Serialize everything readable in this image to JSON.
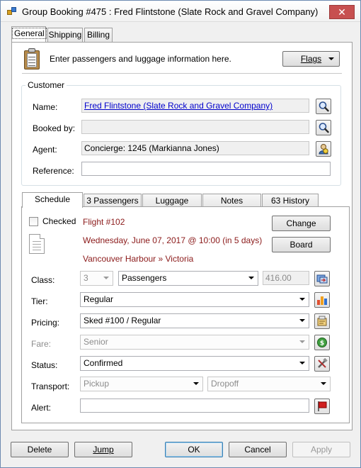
{
  "window": {
    "title": "Group Booking #475 : Fred Flintstone (Slate Rock and Gravel Company)",
    "close_glyph": "✕"
  },
  "top_tabs": [
    "General",
    "Shipping",
    "Billing"
  ],
  "intro": {
    "text": "Enter passengers and luggage information here.",
    "flags_button": "Flags"
  },
  "customer": {
    "group_label": "Customer",
    "name_label": "Name:",
    "name_value": "Fred Flintstone (Slate Rock and Gravel Company)",
    "booked_by_label": "Booked by:",
    "booked_by_value": "",
    "agent_label": "Agent:",
    "agent_value": "Concierge: 1245 (Markianna Jones)",
    "reference_label": "Reference:",
    "reference_value": ""
  },
  "inner_tabs": [
    "Schedule",
    "3 Passengers",
    "Luggage",
    "Notes",
    "63 History"
  ],
  "schedule": {
    "checked_label": "Checked",
    "checked": false,
    "flight": "Flight #102",
    "datetime": "Wednesday, June 07, 2017 @ 10:00 (in 5 days)",
    "route": "Vancouver Harbour » Victoria",
    "change_button": "Change",
    "board_button": "Board",
    "class_label": "Class:",
    "class_qty": "3",
    "class_value": "Passengers",
    "class_price": "416.00",
    "tier_label": "Tier:",
    "tier_value": "Regular",
    "pricing_label": "Pricing:",
    "pricing_value": "Sked #100 / Regular",
    "fare_label": "Fare:",
    "fare_value": "Senior",
    "status_label": "Status:",
    "status_value": "Confirmed",
    "transport_label": "Transport:",
    "pickup_value": "Pickup",
    "dropoff_value": "Dropoff",
    "alert_label": "Alert:",
    "alert_value": ""
  },
  "footer": {
    "delete": "Delete",
    "jump": "Jump",
    "ok": "OK",
    "cancel": "Cancel",
    "apply": "Apply"
  },
  "icons": {
    "app": "app-icon",
    "clipboard": "clipboard-icon",
    "search": "search-icon",
    "agent": "agent-icon",
    "document": "document-icon",
    "class_action": "card-swap-icon",
    "tier": "bar-chart-icon",
    "pricing": "price-tag-icon",
    "fare": "money-icon",
    "status": "tools-icon",
    "alert": "flag-icon"
  },
  "colors": {
    "link": "#0000cc",
    "flight_text": "#8b1a1a",
    "close_button": "#c75050"
  }
}
